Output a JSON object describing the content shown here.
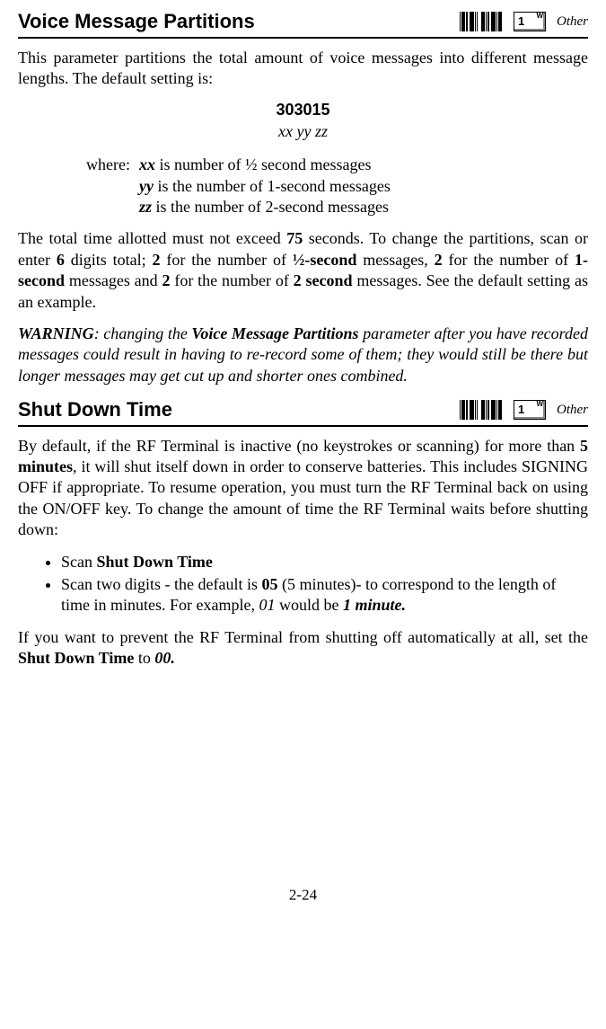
{
  "section1": {
    "title": "Voice Message Partitions",
    "keycap": "1",
    "keycap_sup": "W",
    "other": "Other",
    "intro": "This parameter partitions the total amount of voice messages into different message lengths.  The default setting is:",
    "default_code": "303015",
    "default_vars": "xx yy zz",
    "where_label": "where:",
    "where_xx_var": "xx",
    "where_xx_text": " is number of ½ second messages",
    "where_yy_var": "yy",
    "where_yy_text": " is the number of 1-second messages",
    "where_zz_var": "zz",
    "where_zz_text": " is the number of 2-second messages",
    "para2_a": "The total time allotted must not exceed ",
    "para2_b": "75",
    "para2_c": " seconds.  To change the partitions, scan or enter ",
    "para2_d": "6",
    "para2_e": " digits total; ",
    "para2_f": "2",
    "para2_g": " for the number of ",
    "para2_h": "½-second",
    "para2_i": " messages, ",
    "para2_j": "2",
    "para2_k": " for the number of ",
    "para2_l": "1-second",
    "para2_m": " messages and ",
    "para2_n": "2",
    "para2_o": " for the number of ",
    "para2_p": "2 second",
    "para2_q": " messages.  See the default setting as an example.",
    "warning_a": "WARNING",
    "warning_b": ": changing the ",
    "warning_c": "Voice Message Partitions",
    "warning_d": " parameter after you have recorded messages could result in having to re-record some of them; they would still be there but longer messages may get cut up and shorter ones combined."
  },
  "section2": {
    "title": "Shut Down Time",
    "keycap": "1",
    "keycap_sup": "W",
    "other": "Other",
    "para1_a": "By default, if the RF Terminal is inactive (no keystrokes or scanning) for more than ",
    "para1_b": "5 minutes",
    "para1_c": ", it will shut itself down in order to conserve batteries. This includes SIGNING OFF if appropriate.  To resume operation, you must turn the RF Terminal back on using the ON/OFF key.  To change the amount of time the RF Terminal waits before shutting down:",
    "bullet1_a": "Scan ",
    "bullet1_b": "Shut Down Time",
    "bullet2_a": "Scan two digits - the default is ",
    "bullet2_b": "05",
    "bullet2_c": " (5 minutes)- to correspond to the length of time in minutes. For example, ",
    "bullet2_d": "01",
    "bullet2_e": " would be ",
    "bullet2_f": "1 minute.",
    "para2_a": "If you want to prevent the RF Terminal from shutting off automatically at all, set the ",
    "para2_b": "Shut Down Time",
    "para2_c": " to ",
    "para2_d": "00."
  },
  "page_number": "2-24"
}
